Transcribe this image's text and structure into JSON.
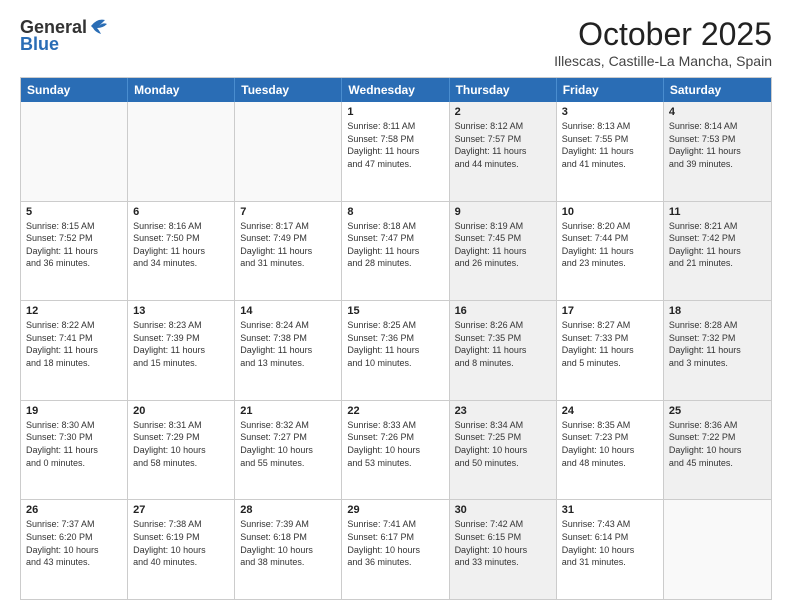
{
  "header": {
    "logo_line1": "General",
    "logo_line2": "Blue",
    "month": "October 2025",
    "location": "Illescas, Castille-La Mancha, Spain"
  },
  "weekdays": [
    "Sunday",
    "Monday",
    "Tuesday",
    "Wednesday",
    "Thursday",
    "Friday",
    "Saturday"
  ],
  "rows": [
    [
      {
        "day": "",
        "info": "",
        "shaded": false,
        "empty": true
      },
      {
        "day": "",
        "info": "",
        "shaded": false,
        "empty": true
      },
      {
        "day": "",
        "info": "",
        "shaded": false,
        "empty": true
      },
      {
        "day": "1",
        "info": "Sunrise: 8:11 AM\nSunset: 7:58 PM\nDaylight: 11 hours\nand 47 minutes.",
        "shaded": false,
        "empty": false
      },
      {
        "day": "2",
        "info": "Sunrise: 8:12 AM\nSunset: 7:57 PM\nDaylight: 11 hours\nand 44 minutes.",
        "shaded": true,
        "empty": false
      },
      {
        "day": "3",
        "info": "Sunrise: 8:13 AM\nSunset: 7:55 PM\nDaylight: 11 hours\nand 41 minutes.",
        "shaded": false,
        "empty": false
      },
      {
        "day": "4",
        "info": "Sunrise: 8:14 AM\nSunset: 7:53 PM\nDaylight: 11 hours\nand 39 minutes.",
        "shaded": true,
        "empty": false
      }
    ],
    [
      {
        "day": "5",
        "info": "Sunrise: 8:15 AM\nSunset: 7:52 PM\nDaylight: 11 hours\nand 36 minutes.",
        "shaded": false,
        "empty": false
      },
      {
        "day": "6",
        "info": "Sunrise: 8:16 AM\nSunset: 7:50 PM\nDaylight: 11 hours\nand 34 minutes.",
        "shaded": false,
        "empty": false
      },
      {
        "day": "7",
        "info": "Sunrise: 8:17 AM\nSunset: 7:49 PM\nDaylight: 11 hours\nand 31 minutes.",
        "shaded": false,
        "empty": false
      },
      {
        "day": "8",
        "info": "Sunrise: 8:18 AM\nSunset: 7:47 PM\nDaylight: 11 hours\nand 28 minutes.",
        "shaded": false,
        "empty": false
      },
      {
        "day": "9",
        "info": "Sunrise: 8:19 AM\nSunset: 7:45 PM\nDaylight: 11 hours\nand 26 minutes.",
        "shaded": true,
        "empty": false
      },
      {
        "day": "10",
        "info": "Sunrise: 8:20 AM\nSunset: 7:44 PM\nDaylight: 11 hours\nand 23 minutes.",
        "shaded": false,
        "empty": false
      },
      {
        "day": "11",
        "info": "Sunrise: 8:21 AM\nSunset: 7:42 PM\nDaylight: 11 hours\nand 21 minutes.",
        "shaded": true,
        "empty": false
      }
    ],
    [
      {
        "day": "12",
        "info": "Sunrise: 8:22 AM\nSunset: 7:41 PM\nDaylight: 11 hours\nand 18 minutes.",
        "shaded": false,
        "empty": false
      },
      {
        "day": "13",
        "info": "Sunrise: 8:23 AM\nSunset: 7:39 PM\nDaylight: 11 hours\nand 15 minutes.",
        "shaded": false,
        "empty": false
      },
      {
        "day": "14",
        "info": "Sunrise: 8:24 AM\nSunset: 7:38 PM\nDaylight: 11 hours\nand 13 minutes.",
        "shaded": false,
        "empty": false
      },
      {
        "day": "15",
        "info": "Sunrise: 8:25 AM\nSunset: 7:36 PM\nDaylight: 11 hours\nand 10 minutes.",
        "shaded": false,
        "empty": false
      },
      {
        "day": "16",
        "info": "Sunrise: 8:26 AM\nSunset: 7:35 PM\nDaylight: 11 hours\nand 8 minutes.",
        "shaded": true,
        "empty": false
      },
      {
        "day": "17",
        "info": "Sunrise: 8:27 AM\nSunset: 7:33 PM\nDaylight: 11 hours\nand 5 minutes.",
        "shaded": false,
        "empty": false
      },
      {
        "day": "18",
        "info": "Sunrise: 8:28 AM\nSunset: 7:32 PM\nDaylight: 11 hours\nand 3 minutes.",
        "shaded": true,
        "empty": false
      }
    ],
    [
      {
        "day": "19",
        "info": "Sunrise: 8:30 AM\nSunset: 7:30 PM\nDaylight: 11 hours\nand 0 minutes.",
        "shaded": false,
        "empty": false
      },
      {
        "day": "20",
        "info": "Sunrise: 8:31 AM\nSunset: 7:29 PM\nDaylight: 10 hours\nand 58 minutes.",
        "shaded": false,
        "empty": false
      },
      {
        "day": "21",
        "info": "Sunrise: 8:32 AM\nSunset: 7:27 PM\nDaylight: 10 hours\nand 55 minutes.",
        "shaded": false,
        "empty": false
      },
      {
        "day": "22",
        "info": "Sunrise: 8:33 AM\nSunset: 7:26 PM\nDaylight: 10 hours\nand 53 minutes.",
        "shaded": false,
        "empty": false
      },
      {
        "day": "23",
        "info": "Sunrise: 8:34 AM\nSunset: 7:25 PM\nDaylight: 10 hours\nand 50 minutes.",
        "shaded": true,
        "empty": false
      },
      {
        "day": "24",
        "info": "Sunrise: 8:35 AM\nSunset: 7:23 PM\nDaylight: 10 hours\nand 48 minutes.",
        "shaded": false,
        "empty": false
      },
      {
        "day": "25",
        "info": "Sunrise: 8:36 AM\nSunset: 7:22 PM\nDaylight: 10 hours\nand 45 minutes.",
        "shaded": true,
        "empty": false
      }
    ],
    [
      {
        "day": "26",
        "info": "Sunrise: 7:37 AM\nSunset: 6:20 PM\nDaylight: 10 hours\nand 43 minutes.",
        "shaded": false,
        "empty": false
      },
      {
        "day": "27",
        "info": "Sunrise: 7:38 AM\nSunset: 6:19 PM\nDaylight: 10 hours\nand 40 minutes.",
        "shaded": false,
        "empty": false
      },
      {
        "day": "28",
        "info": "Sunrise: 7:39 AM\nSunset: 6:18 PM\nDaylight: 10 hours\nand 38 minutes.",
        "shaded": false,
        "empty": false
      },
      {
        "day": "29",
        "info": "Sunrise: 7:41 AM\nSunset: 6:17 PM\nDaylight: 10 hours\nand 36 minutes.",
        "shaded": false,
        "empty": false
      },
      {
        "day": "30",
        "info": "Sunrise: 7:42 AM\nSunset: 6:15 PM\nDaylight: 10 hours\nand 33 minutes.",
        "shaded": true,
        "empty": false
      },
      {
        "day": "31",
        "info": "Sunrise: 7:43 AM\nSunset: 6:14 PM\nDaylight: 10 hours\nand 31 minutes.",
        "shaded": false,
        "empty": false
      },
      {
        "day": "",
        "info": "",
        "shaded": true,
        "empty": true
      }
    ]
  ]
}
